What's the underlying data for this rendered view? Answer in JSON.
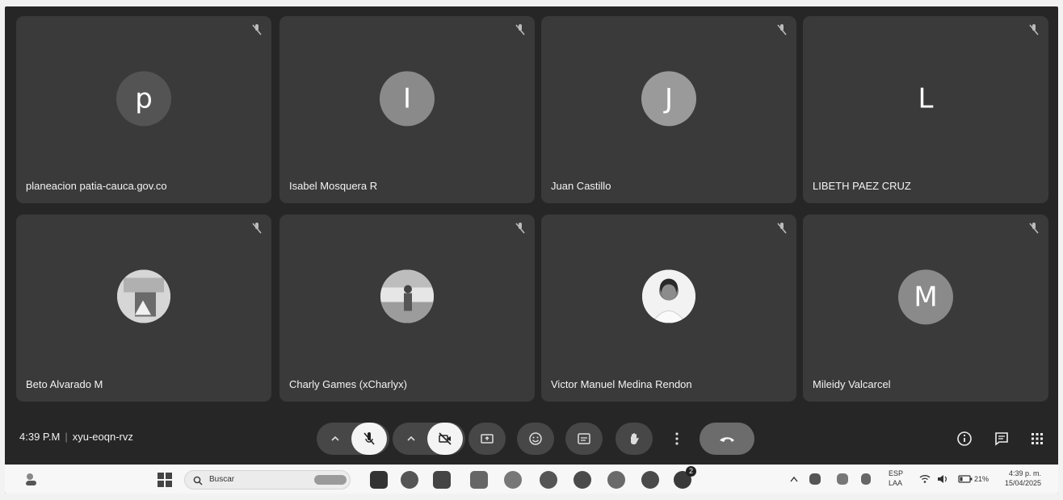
{
  "participants": [
    {
      "name": "planeacion patia-cauca.gov.co",
      "initial": "p",
      "kind": "initial",
      "avatar_color": "#555555"
    },
    {
      "name": "Isabel Mosquera R",
      "initial": "I",
      "kind": "initial",
      "avatar_color": "#8a8a8a"
    },
    {
      "name": "Juan Castillo",
      "initial": "J",
      "kind": "initial",
      "avatar_color": "#9a9a9a"
    },
    {
      "name": "LIBETH PAEZ CRUZ",
      "initial": "L",
      "kind": "initial",
      "avatar_color": "#3a3a3a"
    },
    {
      "name": "Beto Alvarado M",
      "initial": "",
      "kind": "photo",
      "avatar_color": "#c8c8c8"
    },
    {
      "name": "Charly Games (xCharlyx)",
      "initial": "",
      "kind": "photo",
      "avatar_color": "#d8d8d8"
    },
    {
      "name": "Victor Manuel Medina Rendon",
      "initial": "",
      "kind": "photo",
      "avatar_color": "#e8e8e8"
    },
    {
      "name": "Mileidy Valcarcel",
      "initial": "M",
      "kind": "initial",
      "avatar_color": "#8a8a8a"
    }
  ],
  "meeting": {
    "time": "4:39 P.M",
    "code": "xyu-eoqn-rvz"
  },
  "controls": {
    "mic_state": "muted",
    "camera_state": "off",
    "icons": [
      "chevron-up-icon",
      "mic-off-icon",
      "chevron-up-icon",
      "camera-off-icon",
      "present-screen-icon",
      "emoji-icon",
      "captions-icon",
      "raise-hand-icon",
      "more-options-icon",
      "hang-up-icon",
      "info-icon",
      "chat-icon",
      "activities-icon"
    ]
  },
  "taskbar": {
    "search_placeholder": "Buscar",
    "lang_top": "ESP",
    "lang_bottom": "LAA",
    "battery": "21%",
    "clock_time": "4:39 p. m.",
    "clock_date": "15/04/2025",
    "badge_a": "2"
  },
  "colors": {
    "background": "#262626",
    "tile": "#3a3a3a",
    "hangup": "#6c6c6c"
  }
}
